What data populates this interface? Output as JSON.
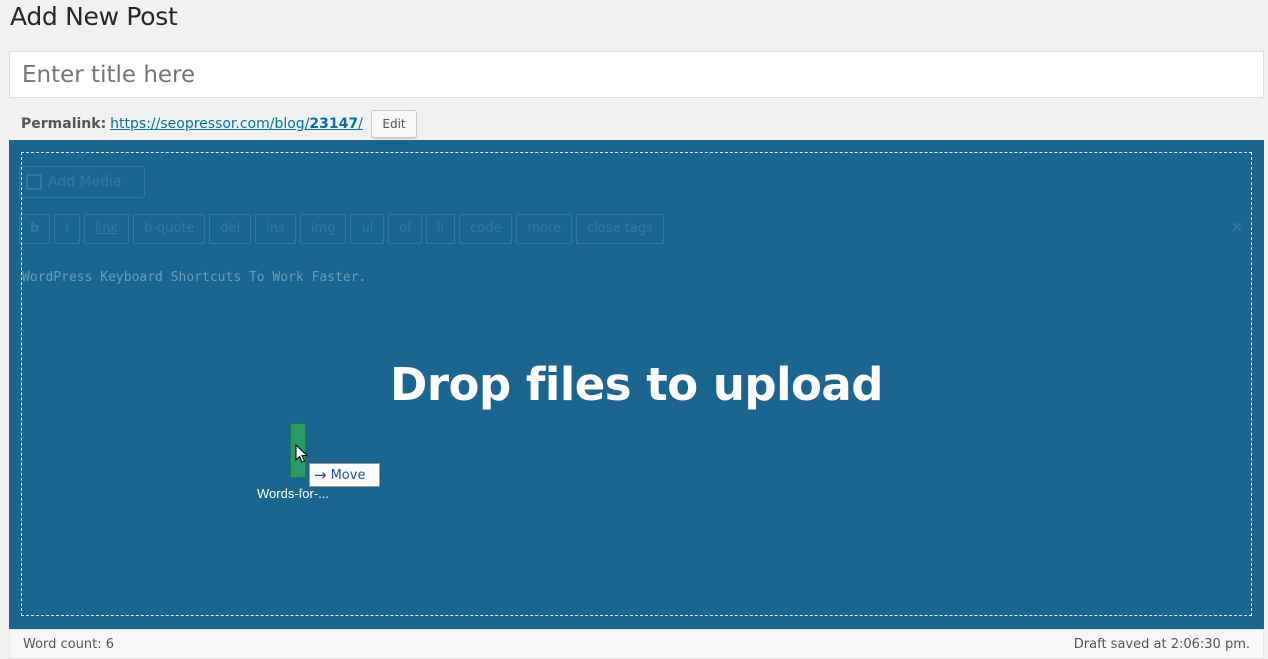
{
  "header": {
    "title": "Add New Post"
  },
  "title_field": {
    "placeholder": "Enter title here",
    "value": ""
  },
  "permalink": {
    "label": "Permalink:",
    "url_prefix": "https://seopressor.com/blog/",
    "url_slug": "23147",
    "url_suffix": "/",
    "edit_label": "Edit"
  },
  "editor": {
    "add_media_label": "Add Media",
    "quicktags": [
      "b",
      "i",
      "link",
      "b-quote",
      "del",
      "ins",
      "img",
      "ul",
      "ol",
      "li",
      "code",
      "more",
      "close tags"
    ],
    "content": "WordPress Keyboard Shortcuts To Work Faster.",
    "drop_message": "Drop files to upload",
    "accent_color": "#1a6690"
  },
  "drag": {
    "tooltip_label": "Move",
    "file_label": "Words-for-..."
  },
  "status": {
    "word_count": "Word count: 6",
    "draft_saved": "Draft saved at 2:06:30 pm."
  }
}
